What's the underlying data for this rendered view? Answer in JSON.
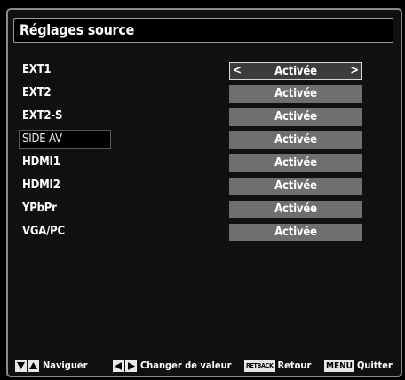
{
  "title": "Réglages source",
  "sources": [
    {
      "name": "EXT1",
      "value": "Activée"
    },
    {
      "name": "EXT2",
      "value": "Activée"
    },
    {
      "name": "EXT2-S",
      "value": "Activée"
    },
    {
      "name": "SIDE AV",
      "value": "Activée"
    },
    {
      "name": "HDMI1",
      "value": "Activée"
    },
    {
      "name": "HDMI2",
      "value": "Activée"
    },
    {
      "name": "YPbPr",
      "value": "Activée"
    },
    {
      "name": "VGA/PC",
      "value": "Activée"
    }
  ],
  "arrows": {
    "left": "<",
    "right": ">"
  },
  "footer": {
    "navigate": "Naviguer",
    "change": "Changer de valeur",
    "return_key": "RETBACK",
    "return": "Retour",
    "menu_key": "MENU",
    "quit": "Quitter"
  },
  "colors": {
    "background": "#000000",
    "value_box": "#6f6f6f",
    "selected_value_box": "#3c3c3c",
    "text": "#ffffff"
  }
}
